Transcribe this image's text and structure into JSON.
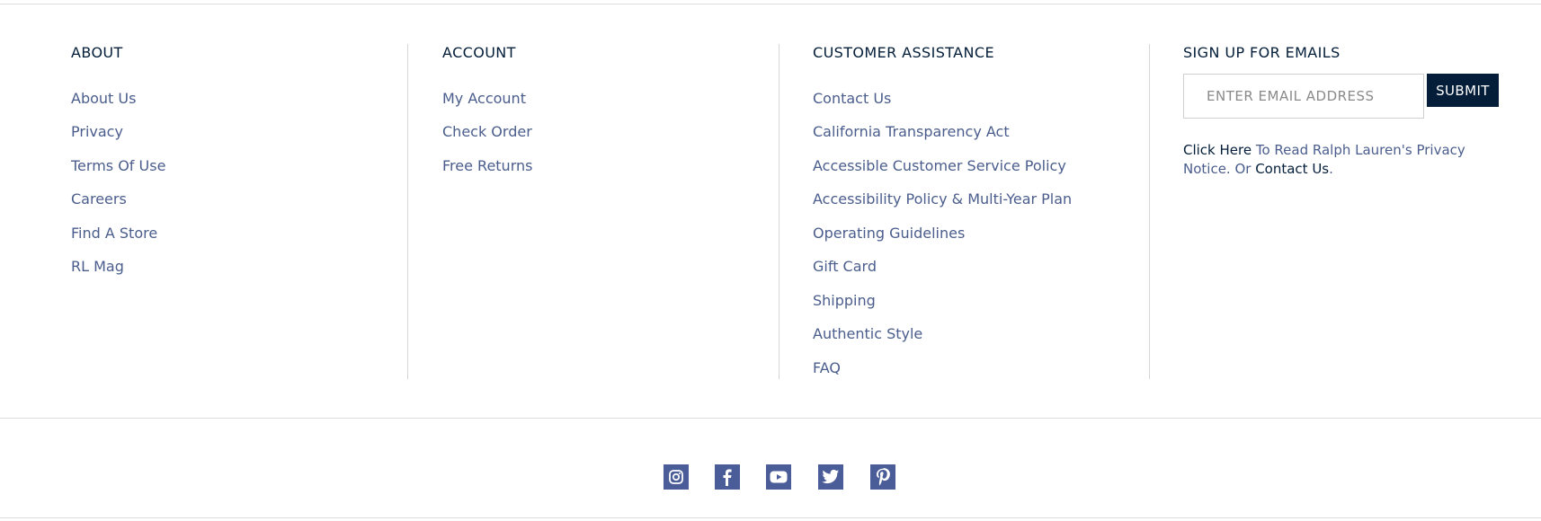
{
  "about": {
    "heading": "ABOUT",
    "links": [
      "About Us",
      "Privacy",
      "Terms Of Use",
      "Careers",
      "Find A Store",
      "RL Mag"
    ]
  },
  "account": {
    "heading": "ACCOUNT",
    "links": [
      "My Account",
      "Check Order",
      "Free Returns"
    ]
  },
  "assistance": {
    "heading": "CUSTOMER ASSISTANCE",
    "links": [
      "Contact Us",
      "California Transparency Act",
      "Accessible Customer Service Policy",
      "Accessibility Policy & Multi-Year Plan",
      "Operating Guidelines",
      "Gift Card",
      "Shipping",
      "Authentic Style",
      "FAQ"
    ]
  },
  "signup": {
    "heading": "SIGN UP FOR EMAILS",
    "email_placeholder": "ENTER EMAIL ADDRESS",
    "email_value": "",
    "submit_label": "SUBMIT",
    "note_click_here": "Click Here",
    "note_middle": " To Read Ralph Lauren's Privacy Notice. Or ",
    "note_contact": "Contact Us",
    "note_end": "."
  },
  "social": {
    "icons": [
      "instagram-icon",
      "facebook-icon",
      "youtube-icon",
      "twitter-icon",
      "pinterest-icon"
    ]
  },
  "colors": {
    "navy": "#041e3a",
    "link": "#4a5d8c",
    "social_bg": "#4a5d98"
  }
}
